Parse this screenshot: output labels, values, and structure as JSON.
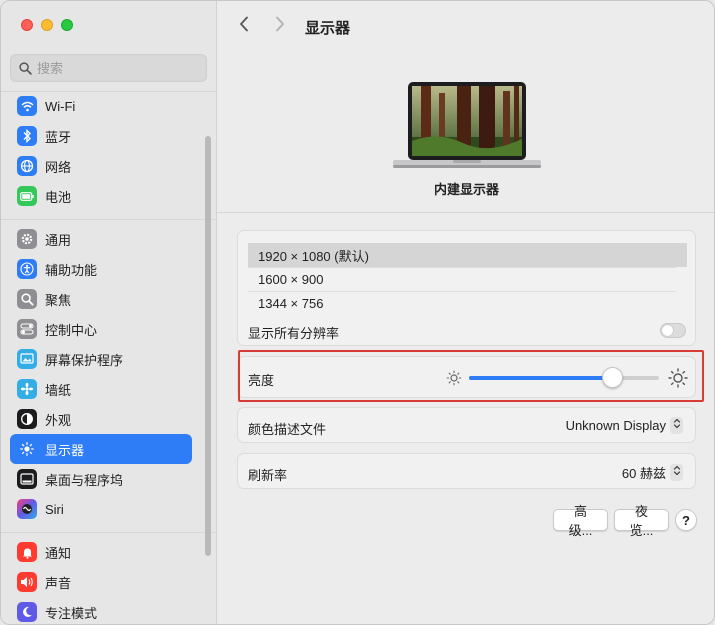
{
  "window": {
    "title": "显示器"
  },
  "sidebar": {
    "search_placeholder": "搜索",
    "items": [
      {
        "label": "Wi-Fi",
        "icon": "wifi-icon",
        "color": "#2f7df6"
      },
      {
        "label": "蓝牙",
        "icon": "bluetooth-icon",
        "color": "#2f7df6"
      },
      {
        "label": "网络",
        "icon": "globe-icon",
        "color": "#2f7df6"
      },
      {
        "label": "电池",
        "icon": "battery-icon",
        "color": "#34c759"
      },
      {
        "label": "通用",
        "icon": "gear-icon",
        "color": "#8e8e93"
      },
      {
        "label": "辅助功能",
        "icon": "accessibility-icon",
        "color": "#2f7df6"
      },
      {
        "label": "聚焦",
        "icon": "spotlight-icon",
        "color": "#8e8e93"
      },
      {
        "label": "控制中心",
        "icon": "control-center-icon",
        "color": "#8e8e93"
      },
      {
        "label": "屏幕保护程序",
        "icon": "screensaver-icon",
        "color": "#32ade6"
      },
      {
        "label": "墙纸",
        "icon": "wallpaper-icon",
        "color": "#32ade6"
      },
      {
        "label": "外观",
        "icon": "appearance-icon",
        "color": "#1c1c1e"
      },
      {
        "label": "显示器",
        "icon": "display-icon",
        "color": "#2f7df6"
      },
      {
        "label": "桌面与程序坞",
        "icon": "dock-icon",
        "color": "#1c1c1e"
      },
      {
        "label": "Siri",
        "icon": "siri-icon",
        "color": "#5e5ce6"
      },
      {
        "label": "通知",
        "icon": "notification-icon",
        "color": "#ff3b30"
      },
      {
        "label": "声音",
        "icon": "sound-icon",
        "color": "#ff3b30"
      },
      {
        "label": "专注模式",
        "icon": "moon-icon",
        "color": "#5e5ce6"
      }
    ]
  },
  "main": {
    "monitor_name": "内建显示器",
    "resolutions": [
      "1920 × 1080 (默认)",
      "1600 × 900",
      "1344 × 756"
    ],
    "show_all_label": "显示所有分辨率",
    "show_all_enabled": false,
    "brightness_label": "亮度",
    "brightness_level": 0.75,
    "color_profile_label": "颜色描述文件",
    "color_profile_value": "Unknown Display",
    "refresh_label": "刷新率",
    "refresh_value": "60 赫兹",
    "advanced_button": "高级...",
    "night_shift_button": "夜览...",
    "help_button": "?"
  },
  "colors": {
    "accent": "#2f7df6",
    "highlight": "#d83b36"
  }
}
